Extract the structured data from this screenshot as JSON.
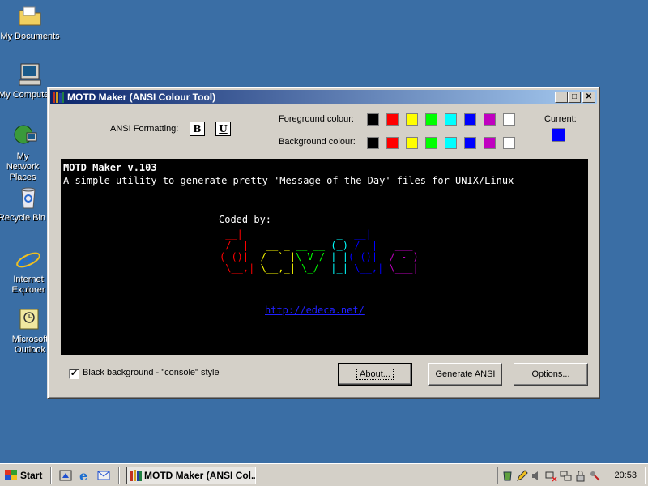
{
  "desktop": {
    "icons": [
      {
        "label": "My Documents",
        "icon": "folder-documents-icon"
      },
      {
        "label": "My Computer",
        "icon": "computer-icon"
      },
      {
        "label": "My Network Places",
        "icon": "network-places-icon"
      },
      {
        "label": "Recycle Bin",
        "icon": "recycle-bin-icon"
      },
      {
        "label": "Internet Explorer",
        "icon": "internet-explorer-icon"
      },
      {
        "label": "Microsoft Outlook",
        "icon": "outlook-icon"
      }
    ]
  },
  "window": {
    "title": "MOTD Maker (ANSI Colour Tool)",
    "controls": {
      "minimize": "_",
      "maximize": "□",
      "close": "✕"
    },
    "ansi_formatting_label": "ANSI Formatting:",
    "bold_label": "B",
    "underline_label": "U",
    "foreground_label": "Foreground colour:",
    "background_label": "Background colour:",
    "current_label": "Current:",
    "current_color": "#0000ff",
    "palette": [
      "#000000",
      "#ff0000",
      "#ffff00",
      "#00ff00",
      "#00ffff",
      "#0000ff",
      "#c000c0",
      "#ffffff"
    ],
    "console": {
      "line1": "MOTD Maker v.103",
      "line2": "A simple utility to generate pretty 'Message of the Day' files for UNIX/Linux",
      "coded_by": "Coded by:",
      "art_letters": [
        {
          "char": "d",
          "color": "#ff0000"
        },
        {
          "char": "a",
          "color": "#ffff00"
        },
        {
          "char": "v",
          "color": "#00ff00"
        },
        {
          "char": "i",
          "color": "#00ffff"
        },
        {
          "char": "d",
          "color": "#0000ff"
        },
        {
          "char": "e",
          "color": "#c000c0"
        }
      ],
      "link": "http://edeca.net/"
    },
    "checkbox_label": "Black background - \"console\" style",
    "checkbox_checked": true,
    "about_button": "About...",
    "generate_button": "Generate ANSI",
    "options_button": "Options..."
  },
  "taskbar": {
    "start_label": "Start",
    "task_label": "MOTD Maker (ANSI Col...",
    "clock": "20:53"
  }
}
